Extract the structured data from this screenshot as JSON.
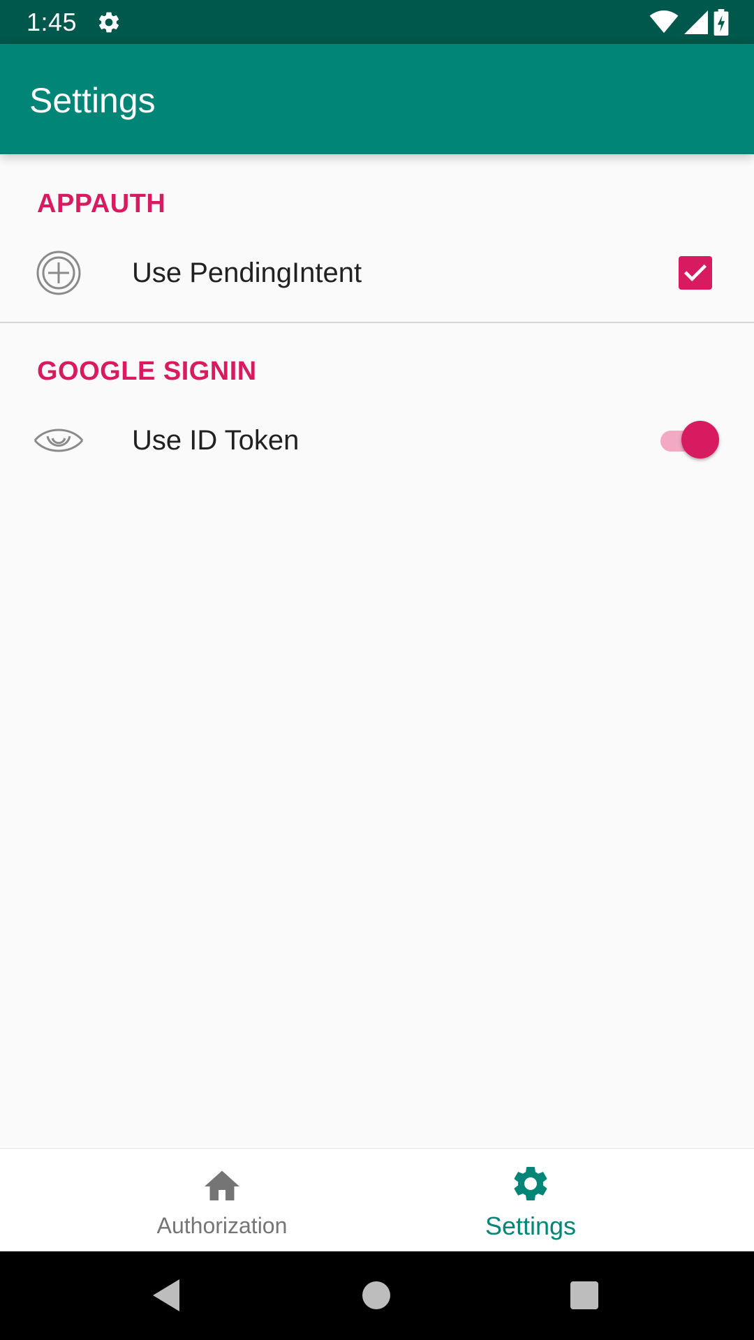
{
  "status_bar": {
    "time": "1:45",
    "icons": [
      "gear-icon",
      "wifi-icon",
      "signal-icon",
      "battery-charging-icon"
    ]
  },
  "app_bar": {
    "title": "Settings"
  },
  "sections": [
    {
      "header": "APPAUTH",
      "items": [
        {
          "icon": "add-circle-icon",
          "label": "Use PendingIntent",
          "control": "checkbox",
          "checked": true
        }
      ]
    },
    {
      "header": "GOOGLE SIGNIN",
      "items": [
        {
          "icon": "eye-icon",
          "label": "Use ID Token",
          "control": "switch",
          "on": true
        }
      ]
    }
  ],
  "bottom_nav": {
    "items": [
      {
        "label": "Authorization",
        "icon": "home-icon",
        "active": false
      },
      {
        "label": "Settings",
        "icon": "settings-icon",
        "active": true
      }
    ]
  },
  "system_nav": {
    "buttons": [
      "back-icon",
      "home-circle-icon",
      "recents-icon"
    ]
  },
  "colors": {
    "status_bar": "#00574b",
    "app_bar": "#008577",
    "accent": "#d81b60",
    "background": "#fafafa"
  }
}
